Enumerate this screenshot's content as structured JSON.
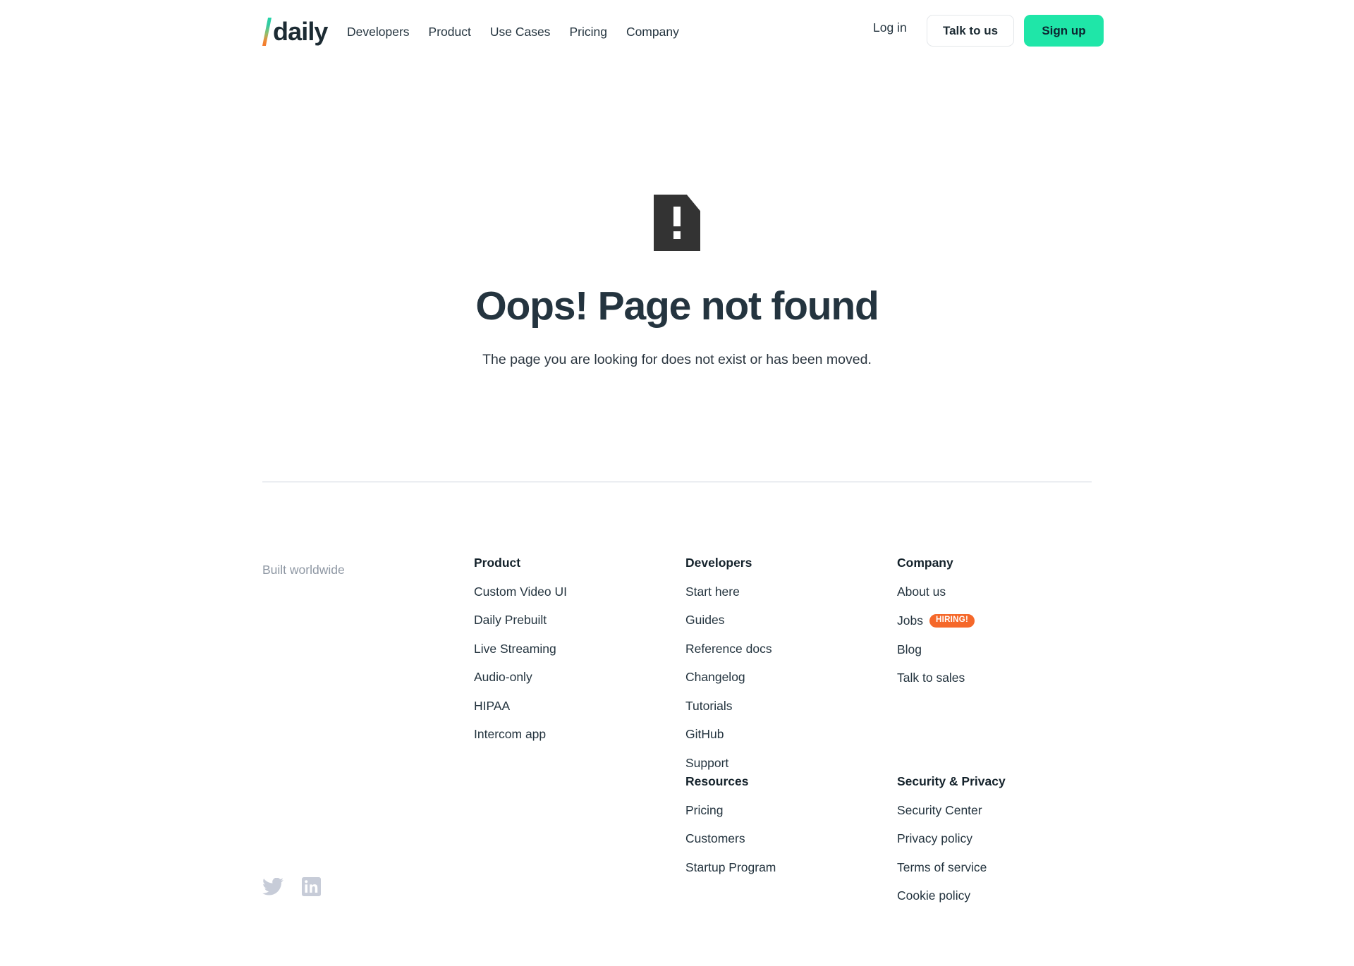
{
  "header": {
    "brand": {
      "slash_icon": "slash-gradient-icon",
      "word": "daily"
    },
    "nav": [
      {
        "label": "Developers"
      },
      {
        "label": "Product"
      },
      {
        "label": "Use Cases"
      },
      {
        "label": "Pricing"
      },
      {
        "label": "Company"
      }
    ],
    "login_label": "Log in",
    "talk_label": "Talk to us",
    "signup_label": "Sign up"
  },
  "hero": {
    "icon": "document-alert-icon",
    "title": "Oops! Page not found",
    "subtitle": "The page you are looking for does not exist or has been moved."
  },
  "footer": {
    "tagline": "Built worldwide",
    "columns": {
      "product": {
        "title": "Product",
        "links": [
          {
            "label": "Custom Video UI"
          },
          {
            "label": "Daily Prebuilt"
          },
          {
            "label": "Live Streaming"
          },
          {
            "label": "Audio-only"
          },
          {
            "label": "HIPAA"
          },
          {
            "label": "Intercom app"
          }
        ]
      },
      "developers": {
        "title": "Developers",
        "links": [
          {
            "label": "Start here"
          },
          {
            "label": "Guides"
          },
          {
            "label": "Reference docs"
          },
          {
            "label": "Changelog"
          },
          {
            "label": "Tutorials"
          },
          {
            "label": "GitHub"
          },
          {
            "label": "Support"
          }
        ]
      },
      "company": {
        "title": "Company",
        "links": [
          {
            "label": "About us"
          },
          {
            "label": "Jobs",
            "badge": "HIRING!"
          },
          {
            "label": "Blog"
          },
          {
            "label": "Talk to sales"
          }
        ]
      },
      "resources": {
        "title": "Resources",
        "links": [
          {
            "label": "Pricing"
          },
          {
            "label": "Customers"
          },
          {
            "label": "Startup Program"
          }
        ]
      },
      "security": {
        "title": "Security & Privacy",
        "links": [
          {
            "label": "Security Center"
          },
          {
            "label": "Privacy policy"
          },
          {
            "label": "Terms of service"
          },
          {
            "label": "Cookie policy"
          }
        ]
      }
    },
    "socials": [
      {
        "icon": "twitter-icon"
      },
      {
        "icon": "linkedin-icon"
      }
    ]
  },
  "colors": {
    "accent_green": "#1fe6a8",
    "badge_orange": "#f5682a",
    "text_dark": "#24343f",
    "text_muted": "#8e97a3",
    "divider": "#ccd2dc",
    "social_icon": "#c7ccd8"
  }
}
